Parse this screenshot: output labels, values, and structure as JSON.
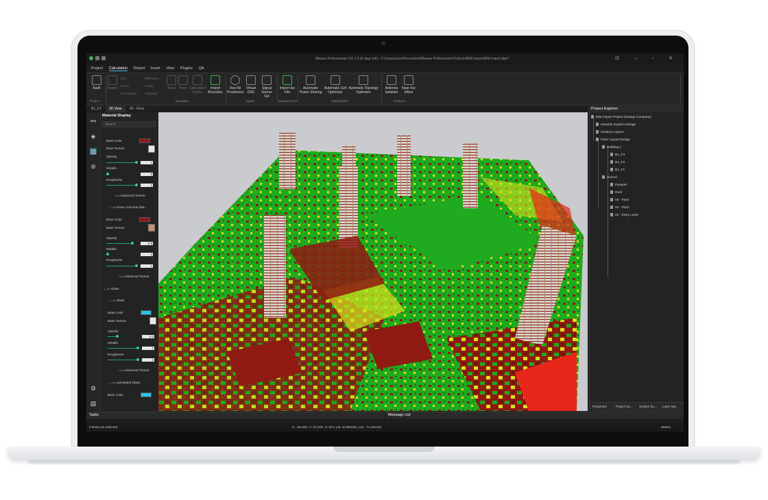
{
  "window": {
    "title": "iBwave Professional V11.1.0 (6 days left) - C:\\Users\\user\\Documents\\iBwave Professional Projects\\BIM Import\\BIM Import.ibpx*"
  },
  "menu": [
    "Project",
    "Calculation",
    "Report",
    "Insert",
    "View",
    "Plugins",
    "QA"
  ],
  "menu_active": "Calculation",
  "ribbon": {
    "buttons": [
      {
        "label": "Audit",
        "dim": false
      },
      {
        "label": "Region",
        "dim": true
      },
      {
        "label": "Trace",
        "dim": true
      },
      {
        "label": "Point",
        "dim": true
      },
      {
        "label": "Calculation Points",
        "dim": true
      },
      {
        "label": "Import Boundary",
        "dim": false
      },
      {
        "label": "Run All Predictions",
        "dim": false
      },
      {
        "label": "Virtual DAS",
        "dim": false
      },
      {
        "label": "Signal Source Set",
        "dim": false
      },
      {
        "label": "Import Ibx File",
        "dim": false
      },
      {
        "label": "Automatic Power Sharing",
        "dim": false
      },
      {
        "label": "Automatic Cell Optimizer",
        "dim": false
      },
      {
        "label": "Automatic Topology Optimizer",
        "dim": false
      },
      {
        "label": "Antenna Isolation",
        "dim": false
      },
      {
        "label": "Near-Far Effect",
        "dim": false
      }
    ],
    "small_items": [
      "Box",
      "Union",
      "Intersection",
      "Difference",
      "Group",
      "Ungroup"
    ],
    "groups": [
      "Project",
      "Boundary",
      "Signal",
      "Measurement",
      "Optimization",
      "Analysis"
    ]
  },
  "view_tabs": [
    "B1_F1",
    "3D View",
    "03 - Floor"
  ],
  "active_view_tab": "3D View",
  "material_panel": {
    "title": "Material Display",
    "search_placeholder": "Search",
    "labels": {
      "base_color": "Base Color",
      "base_texture": "Base Texture",
      "opacity": "Opacity",
      "metallic": "Metallic",
      "roughness": "Roughness",
      "advanced_texture": "Advanced Texture",
      "foam_concrete": "Foam Concrete (Ma...",
      "glass_group": "Glass",
      "glass_item": "Glass",
      "laminated_glass": "Laminated Glass"
    },
    "values": {
      "opacity1": "1",
      "metallic1": "0",
      "roughness1": "1",
      "opacity2": "0.9",
      "metallic2": "0",
      "roughness2": "1",
      "opacity3": "0.3",
      "metallic3": "1",
      "roughness3": "1"
    },
    "colors": {
      "swatch1": "#8b1a1a",
      "swatch2": "#8b1a1a",
      "swatch3": "#29c4e8",
      "swatch4": "#29c4e8"
    }
  },
  "project_explorer": {
    "title": "Project Explorer",
    "items": [
      "BIM Import Project (Design Company)",
      "Network System Design",
      "Outdoor Layout",
      "Floor Layout Design",
      "Building 1",
      "B1_F3",
      "B1_F2",
      "B1_F1",
      "School",
      "Parapet",
      "Roof",
      "03 - Floor",
      "02 - Floor",
      "01 - Entry Level"
    ],
    "tabs": [
      "Properties",
      "Project Ex...",
      "System Ex...",
      "Layer Ma..."
    ]
  },
  "bottom": {
    "tasks_title": "Tasks",
    "messages_title": "Message List",
    "status_left": "0 items are selected.",
    "coords": "X: -35.64m, Y: 22.24m, Z: 0m | Lat: 42.991192, Lon: -71.461443",
    "units": "Meters"
  },
  "heatmap_colors": {
    "strong": "#1faa1f",
    "mid": "#d9e21c",
    "weak": "#8e1a12",
    "hot": "#e8261a"
  }
}
